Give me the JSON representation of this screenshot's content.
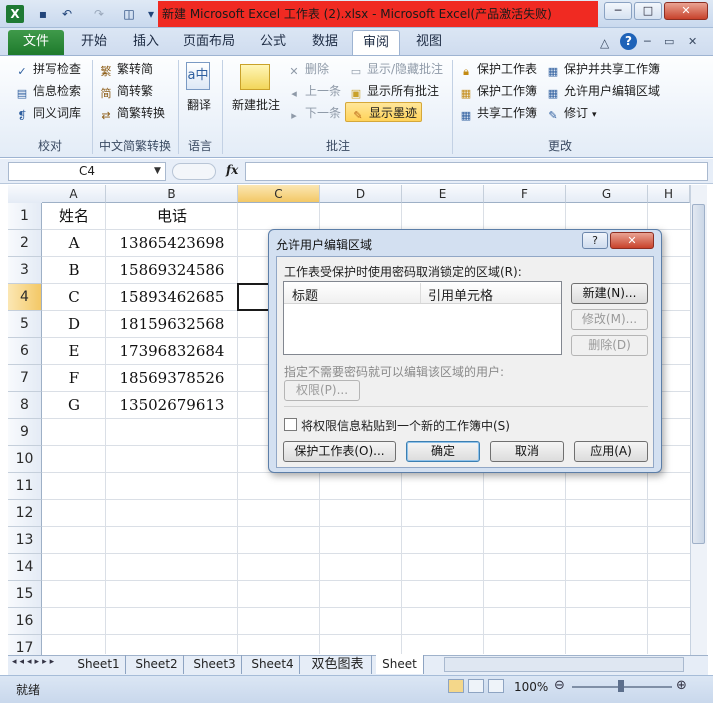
{
  "window": {
    "title": "新建 Microsoft Excel 工作表 (2).xlsx - Microsoft Excel(产品激活失败)",
    "minimize": "─",
    "maximize": "□",
    "close": "✕"
  },
  "qat": {
    "logo": "X",
    "save": "▪",
    "undo": "↶",
    "redo": "↷",
    "preview": "◫",
    "more": "▾"
  },
  "tabs": [
    "文件",
    "开始",
    "插入",
    "页面布局",
    "公式",
    "数据",
    "审阅",
    "视图"
  ],
  "ribbon": {
    "proofing": {
      "spell": "拼写检查",
      "research": "信息检索",
      "thesaurus": "同义词库",
      "group": "校对"
    },
    "chinese": {
      "t2s": "繁转简",
      "s2t": "简转繁",
      "convert": "简繁转换",
      "group": "中文简繁转换"
    },
    "language": {
      "translate": "翻译",
      "group": "语言"
    },
    "comments": {
      "new": "新建批注",
      "delete": "删除",
      "prev": "上一条",
      "next": "下一条",
      "showhide": "显示/隐藏批注",
      "showall": "显示所有批注",
      "ink": "显示墨迹",
      "group": "批注"
    },
    "changes": {
      "protect_sheet": "保护工作表",
      "protect_book": "保护工作簿",
      "share": "共享工作簿",
      "protect_share": "保护并共享工作簿",
      "allow_edit": "允许用户编辑区域",
      "track": "修订",
      "group": "更改"
    }
  },
  "formula": {
    "namebox": "C4",
    "fx": "fx"
  },
  "columns": [
    "A",
    "B",
    "C",
    "D",
    "E",
    "F",
    "G",
    "H"
  ],
  "rows": [
    "1",
    "2",
    "3",
    "4",
    "5",
    "6",
    "7",
    "8",
    "9",
    "10",
    "11",
    "12",
    "13",
    "14",
    "15",
    "16",
    "17"
  ],
  "table": {
    "header": [
      "姓名",
      "电话"
    ],
    "data": [
      [
        "A",
        "13865423698"
      ],
      [
        "B",
        "15869324586"
      ],
      [
        "C",
        "15893462685"
      ],
      [
        "D",
        "18159632568"
      ],
      [
        "E",
        "17396832684"
      ],
      [
        "F",
        "18569378526"
      ],
      [
        "G",
        "13502679613"
      ]
    ]
  },
  "sheets": [
    "Sheet1",
    "Sheet2",
    "Sheet3",
    "Sheet4",
    "双色图表",
    "Sheet"
  ],
  "status": {
    "ready": "就绪",
    "zoom": "100%"
  },
  "dialog": {
    "title": "允许用户编辑区域",
    "help": "?",
    "close": "✕",
    "ranges_label": "工作表受保护时使用密码取消锁定的区域(R):",
    "col_title": "标题",
    "col_ref": "引用单元格",
    "new": "新建(N)...",
    "modify": "修改(M)...",
    "delete": "删除(D)",
    "users_label": "指定不需要密码就可以编辑该区域的用户:",
    "permissions": "权限(P)...",
    "paste_check": "将权限信息粘贴到一个新的工作簿中(S)",
    "protect": "保护工作表(O)...",
    "ok": "确定",
    "cancel": "取消",
    "apply": "应用(A)"
  }
}
